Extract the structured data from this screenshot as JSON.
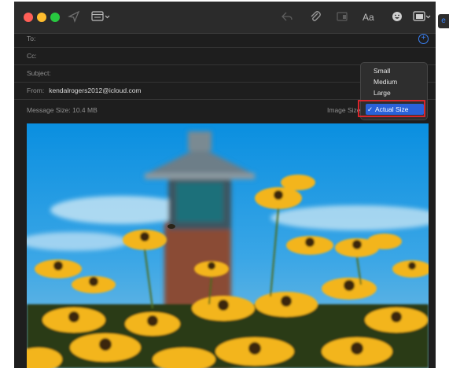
{
  "colors": {
    "window_bg": "#1e1e1e",
    "accent": "#2a62d9",
    "highlight_border": "#d9262c",
    "close": "#ff5f57",
    "minimize": "#febc2e",
    "zoom": "#28c840"
  },
  "toolbar": {
    "icons": [
      "send-icon",
      "header-fields-icon",
      "reply-icon",
      "attachment-icon",
      "photo-browser-icon",
      "format-icon",
      "emoji-icon",
      "photo-insert-icon"
    ],
    "format_label": "Aa"
  },
  "header": {
    "to_label": "To:",
    "cc_label": "Cc:",
    "subject_label": "Subject:",
    "from_label": "From:",
    "from_value": "kendalrogers2012@icloud.com",
    "message_size_label": "Message Size: 10.4 MB",
    "image_size_label": "Image Size"
  },
  "image_size_menu": {
    "options": [
      "Small",
      "Medium",
      "Large",
      "Actual Size"
    ],
    "selected": "Actual Size",
    "check_glyph": "✓"
  },
  "side_tab_glyph": "e"
}
